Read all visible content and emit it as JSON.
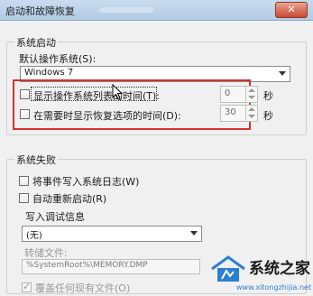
{
  "window": {
    "title": "启动和故障恢复",
    "close_label": "✕"
  },
  "startup": {
    "group_label": "系统启动",
    "default_os_label": "默认操作系统(S):",
    "default_os_value": "Windows 7",
    "show_os_list": {
      "label": "显示操作系统列表的时间(T):",
      "checked": false,
      "value": "0",
      "unit": "秒"
    },
    "show_recovery": {
      "label": "在需要时显示恢复选项的时间(D):",
      "checked": false,
      "value": "30",
      "unit": "秒"
    },
    "highlight_color": "#d8302b"
  },
  "failure": {
    "group_label": "系统失败",
    "write_log_label": "将事件写入系统日志(W)",
    "auto_restart_label": "自动重新启动(R)",
    "debug_info_label": "写入调试信息",
    "debug_info_value": "(无)",
    "dump_file_label": "转储文件:",
    "dump_file_value": "%SystemRoot%\\MEMORY.DMP",
    "overwrite_label": "覆盖任何现有文件(O)"
  },
  "watermark": {
    "text": "系统之家",
    "url": "www.xitongzhijia.net",
    "color": "#2a7fd4"
  }
}
